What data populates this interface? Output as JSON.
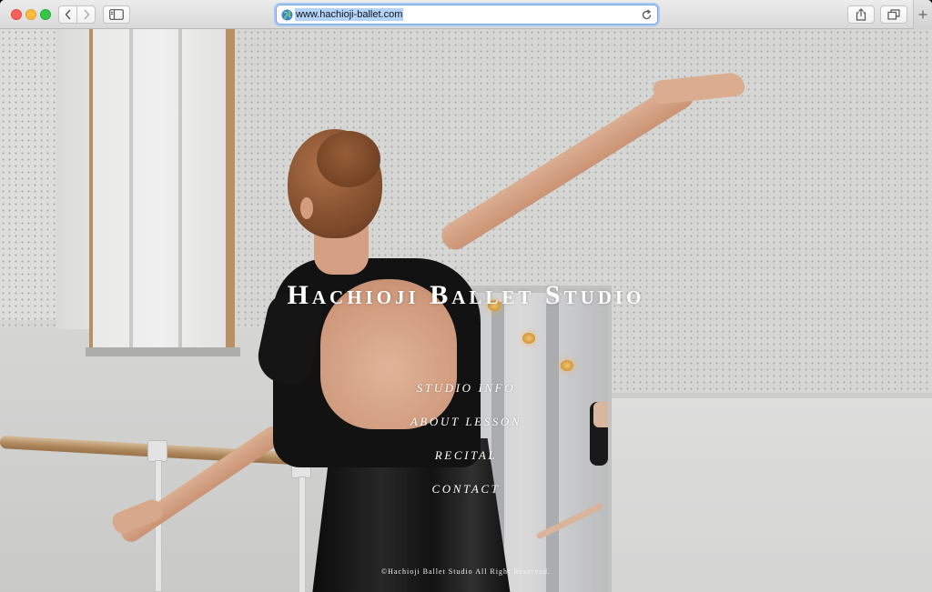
{
  "browser": {
    "url": "www.hachioji-ballet.com",
    "icons": {
      "back": "chevron-left-icon",
      "forward": "chevron-right-icon",
      "sidebar": "sidebar-icon",
      "share": "share-icon",
      "tabs": "tabs-icon",
      "new_tab": "plus-icon",
      "site": "globe-icon",
      "reload": "reload-icon"
    },
    "colors": {
      "close": "#fc605b",
      "minimize": "#fdbc40",
      "maximize": "#34c84a",
      "url_focus": "#7aa7e6"
    }
  },
  "site": {
    "title": "Hachioji Ballet Studio",
    "nav": [
      {
        "label": "STUDIO INFO"
      },
      {
        "label": "ABOUT LESSON"
      },
      {
        "label": "RECITAL"
      },
      {
        "label": "CONTACT"
      }
    ],
    "copyright": "©Hachioji Ballet Studio All Right Reserved."
  }
}
